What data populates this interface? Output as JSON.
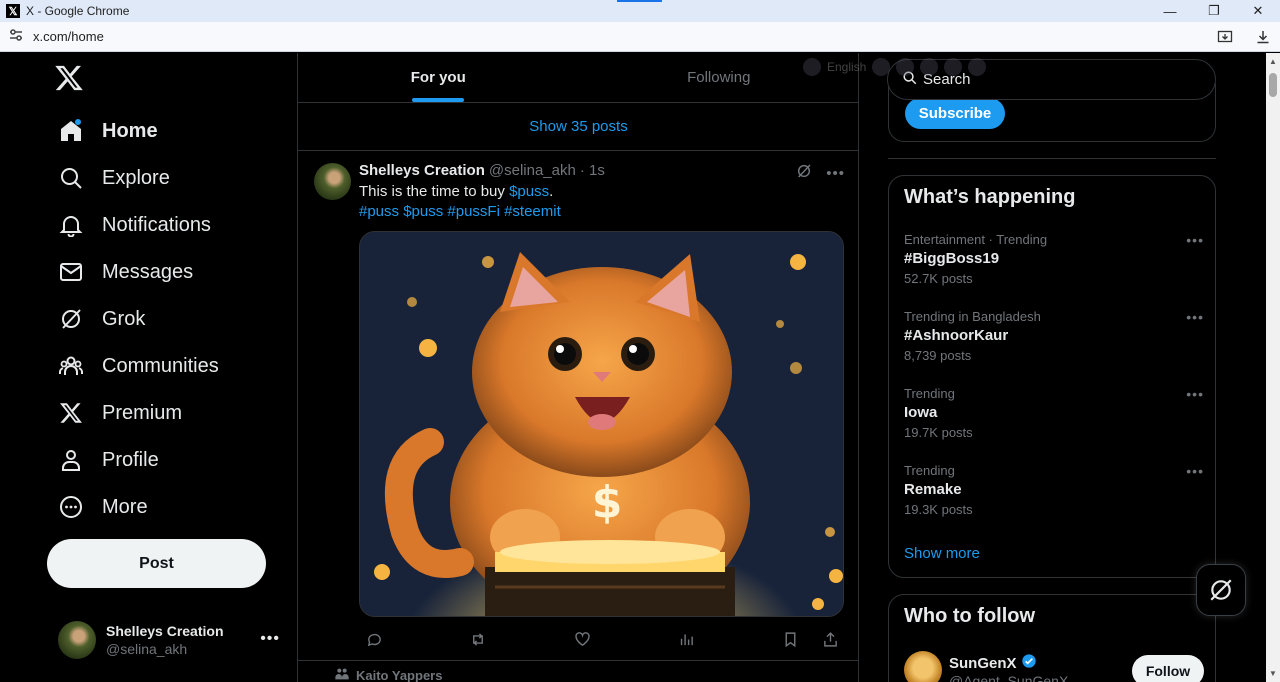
{
  "browser": {
    "window_title": "X - Google Chrome",
    "url": "x.com/home",
    "minimize": "—",
    "restore": "❐",
    "close": "✕"
  },
  "nav": {
    "items": [
      {
        "label": "Home",
        "icon": "home-icon"
      },
      {
        "label": "Explore",
        "icon": "search-icon"
      },
      {
        "label": "Notifications",
        "icon": "bell-icon"
      },
      {
        "label": "Messages",
        "icon": "envelope-icon"
      },
      {
        "label": "Grok",
        "icon": "grok-icon"
      },
      {
        "label": "Communities",
        "icon": "people-icon"
      },
      {
        "label": "Premium",
        "icon": "x-icon"
      },
      {
        "label": "Profile",
        "icon": "person-icon"
      },
      {
        "label": "More",
        "icon": "more-circle-icon"
      }
    ],
    "post_label": "Post",
    "account": {
      "name": "Shelleys Creation",
      "handle": "@selina_akh"
    }
  },
  "timeline": {
    "tabs": [
      "For you",
      "Following"
    ],
    "show_posts": "Show 35 posts",
    "tweet": {
      "name": "Shelleys Creation",
      "handle": "@selina_akh",
      "time": "· 1s",
      "text_prefix": "This is the time to buy ",
      "text_link": "$puss",
      "text_suffix": ".",
      "hashtags": "#puss $puss #pussFi #steemit"
    },
    "next_post_label": "Kaito Yappers"
  },
  "sidebar": {
    "search_placeholder": "Search",
    "subscribe_label": "Subscribe",
    "happening_title": "What’s happening",
    "trends": [
      {
        "category": "Entertainment · Trending",
        "name": "#BiggBoss19",
        "count": "52.7K posts"
      },
      {
        "category": "Trending in Bangladesh",
        "name": "#AshnoorKaur",
        "count": "8,739 posts"
      },
      {
        "category": "Trending",
        "name": "Iowa",
        "count": "19.7K posts"
      },
      {
        "category": "Trending",
        "name": "Remake",
        "count": "19.3K posts"
      }
    ],
    "show_more": "Show more",
    "who_to_follow_title": "Who to follow",
    "suggestion": {
      "name": "SunGenX",
      "handle": "@Agent_SunGenX",
      "follow_label": "Follow"
    }
  },
  "overlay": {
    "language": "English"
  },
  "colors": {
    "accent": "#1d9bf0",
    "background": "#000000",
    "border": "#2f3336",
    "muted": "#71767b"
  }
}
